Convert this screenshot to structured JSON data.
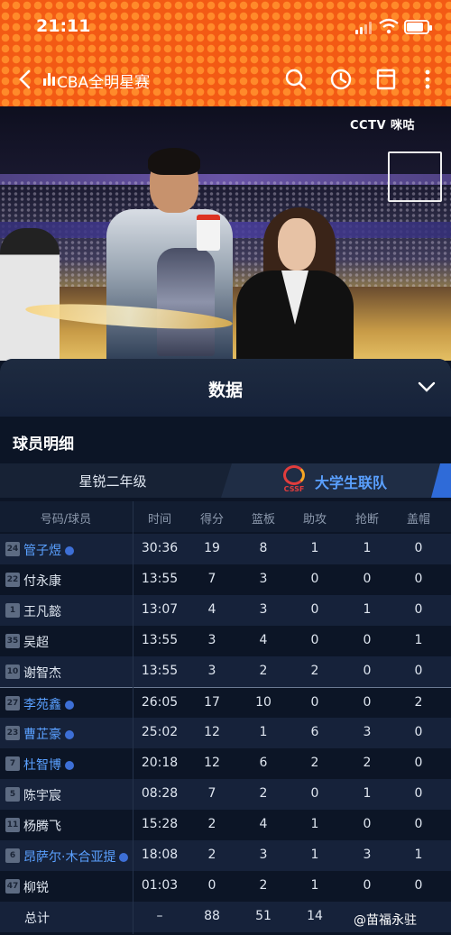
{
  "status_bar": {
    "time": "21:11"
  },
  "nav": {
    "title": "CBA全明星赛"
  },
  "video": {
    "broadcaster_logo": "CCTV 咪咕"
  },
  "panel": {
    "title": "数据",
    "section_title": "球员明细",
    "team_left": "星锐二年级",
    "team_right": "大学生联队",
    "team_right_logo_text": "CSSF"
  },
  "table": {
    "headers": [
      "号码/球员",
      "时间",
      "得分",
      "篮板",
      "助攻",
      "抢断",
      "盖帽"
    ],
    "rows": [
      {
        "num": "24",
        "name": "管子煜",
        "starter": true,
        "time": "30:36",
        "pts": "19",
        "reb": "8",
        "ast": "1",
        "stl": "1",
        "blk": "0"
      },
      {
        "num": "22",
        "name": "付永康",
        "starter": false,
        "time": "13:55",
        "pts": "7",
        "reb": "3",
        "ast": "0",
        "stl": "0",
        "blk": "0"
      },
      {
        "num": "1",
        "name": "王凡懿",
        "starter": false,
        "time": "13:07",
        "pts": "4",
        "reb": "3",
        "ast": "0",
        "stl": "1",
        "blk": "0"
      },
      {
        "num": "35",
        "name": "吴超",
        "starter": false,
        "time": "13:55",
        "pts": "3",
        "reb": "4",
        "ast": "0",
        "stl": "0",
        "blk": "1"
      },
      {
        "num": "10",
        "name": "谢智杰",
        "starter": false,
        "time": "13:55",
        "pts": "3",
        "reb": "2",
        "ast": "2",
        "stl": "0",
        "blk": "0"
      },
      {
        "num": "27",
        "name": "李苑鑫",
        "starter": true,
        "time": "26:05",
        "pts": "17",
        "reb": "10",
        "ast": "0",
        "stl": "0",
        "blk": "2"
      },
      {
        "num": "23",
        "name": "曹芷豪",
        "starter": true,
        "time": "25:02",
        "pts": "12",
        "reb": "1",
        "ast": "6",
        "stl": "3",
        "blk": "0"
      },
      {
        "num": "7",
        "name": "杜智博",
        "starter": true,
        "time": "20:18",
        "pts": "12",
        "reb": "6",
        "ast": "2",
        "stl": "2",
        "blk": "0"
      },
      {
        "num": "5",
        "name": "陈宇宸",
        "starter": false,
        "time": "08:28",
        "pts": "7",
        "reb": "2",
        "ast": "0",
        "stl": "1",
        "blk": "0"
      },
      {
        "num": "11",
        "name": "杨腾飞",
        "starter": false,
        "time": "15:28",
        "pts": "2",
        "reb": "4",
        "ast": "1",
        "stl": "0",
        "blk": "0"
      },
      {
        "num": "6",
        "name": "昂萨尔·木合亚提",
        "starter": true,
        "time": "18:08",
        "pts": "2",
        "reb": "3",
        "ast": "1",
        "stl": "3",
        "blk": "1"
      },
      {
        "num": "47",
        "name": "柳锐",
        "starter": false,
        "time": "01:03",
        "pts": "0",
        "reb": "2",
        "ast": "1",
        "stl": "0",
        "blk": "0"
      }
    ],
    "total": {
      "label": "总计",
      "time": "–",
      "pts": "88",
      "reb": "51",
      "ast": "14"
    }
  },
  "watermark": "@苗福永驻",
  "colors": {
    "header_orange": "#f35a14",
    "panel_bg": "#0c1526",
    "accent_blue": "#5aa0ff"
  }
}
